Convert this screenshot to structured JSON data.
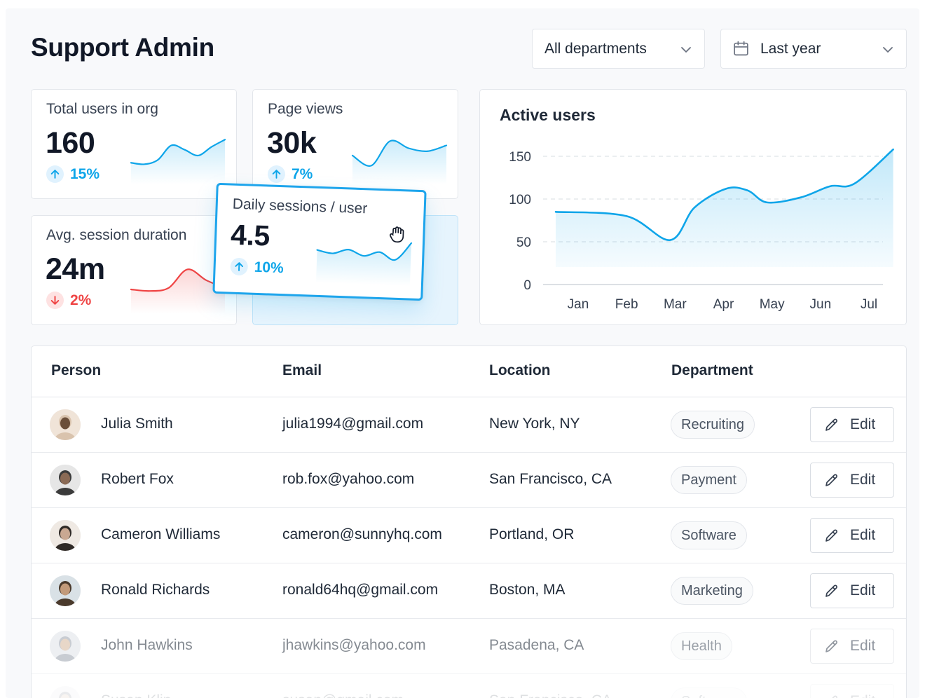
{
  "header": {
    "title": "Support Admin",
    "department_filter": "All departments",
    "date_filter": "Last year"
  },
  "stats": [
    {
      "label": "Total users in org",
      "value": "160",
      "change": "15%",
      "direction": "up",
      "sparkline": [
        0.2,
        0.15,
        0.3,
        0.8,
        0.65,
        0.45,
        0.75,
        1.0
      ]
    },
    {
      "label": "Page views",
      "value": "30k",
      "change": "7%",
      "direction": "up",
      "sparkline": [
        0.45,
        0.1,
        0.95,
        0.7,
        0.6,
        0.8
      ]
    },
    {
      "label": "Avg. session duration",
      "value": "24m",
      "change": "2%",
      "direction": "down",
      "sparkline": [
        0.25,
        0.2,
        0.3,
        0.9,
        0.55,
        0.3
      ]
    }
  ],
  "floating_card": {
    "label": "Daily sessions / user",
    "value": "4.5",
    "change": "10%",
    "direction": "up",
    "sparkline": [
      0.6,
      0.5,
      0.65,
      0.45,
      0.6,
      0.35,
      0.95
    ]
  },
  "chart_data": {
    "type": "area",
    "title": "Active users",
    "categories": [
      "Jan",
      "Feb",
      "Mar",
      "Apr",
      "May",
      "Jun",
      "Jul"
    ],
    "x": [
      0.25,
      1.0,
      1.9,
      2.4,
      3.05,
      3.5,
      3.9,
      4.6,
      5.2,
      5.7,
      6.5
    ],
    "y": [
      85,
      80,
      52,
      90,
      112,
      110,
      96,
      102,
      115,
      118,
      158
    ],
    "yticks": [
      0,
      50,
      100,
      150
    ],
    "ylim": [
      0,
      170
    ],
    "grid": true,
    "color": "#0ea5e9"
  },
  "table": {
    "columns": [
      "Person",
      "Email",
      "Location",
      "Department"
    ],
    "edit_label": "Edit",
    "rows": [
      {
        "name": "Julia Smith",
        "email": "julia1994@gmail.com",
        "location": "New York, NY",
        "department": "Recruiting"
      },
      {
        "name": "Robert Fox",
        "email": "rob.fox@yahoo.com",
        "location": "San Francisco, CA",
        "department": "Payment"
      },
      {
        "name": "Cameron Williams",
        "email": "cameron@sunnyhq.com",
        "location": "Portland, OR",
        "department": "Software"
      },
      {
        "name": "Ronald Richards",
        "email": "ronald64hq@gmail.com",
        "location": "Boston, MA",
        "department": "Marketing"
      },
      {
        "name": "John Hawkins",
        "email": "jhawkins@yahoo.com",
        "location": "Pasadena, CA",
        "department": "Health"
      },
      {
        "name": "Susan Klin",
        "email": "susan@gmail.com",
        "location": "San Francisco, CA",
        "department": "Software"
      }
    ]
  },
  "colors": {
    "accent": "#0ea5e9",
    "negative": "#ef4444",
    "text": "#111827",
    "border": "#e3e6eb"
  }
}
